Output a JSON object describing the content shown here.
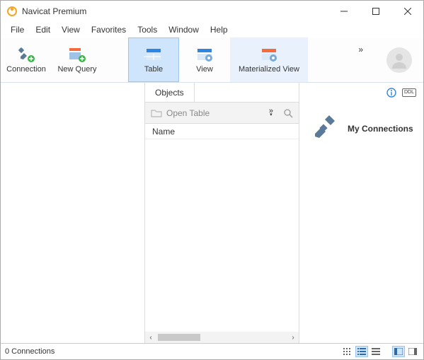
{
  "window": {
    "title": "Navicat Premium"
  },
  "menu": {
    "items": [
      "File",
      "Edit",
      "View",
      "Favorites",
      "Tools",
      "Window",
      "Help"
    ]
  },
  "toolbar": {
    "connection": "Connection",
    "new_query": "New Query",
    "table": "Table",
    "view": "View",
    "mat_view": "Materialized View",
    "more": "»"
  },
  "mid": {
    "tab_objects": "Objects",
    "open_table": "Open Table",
    "col_name": "Name",
    "more": "»"
  },
  "right": {
    "title": "My Connections",
    "ddl": "DDL"
  },
  "status": {
    "text": "0 Connections"
  }
}
